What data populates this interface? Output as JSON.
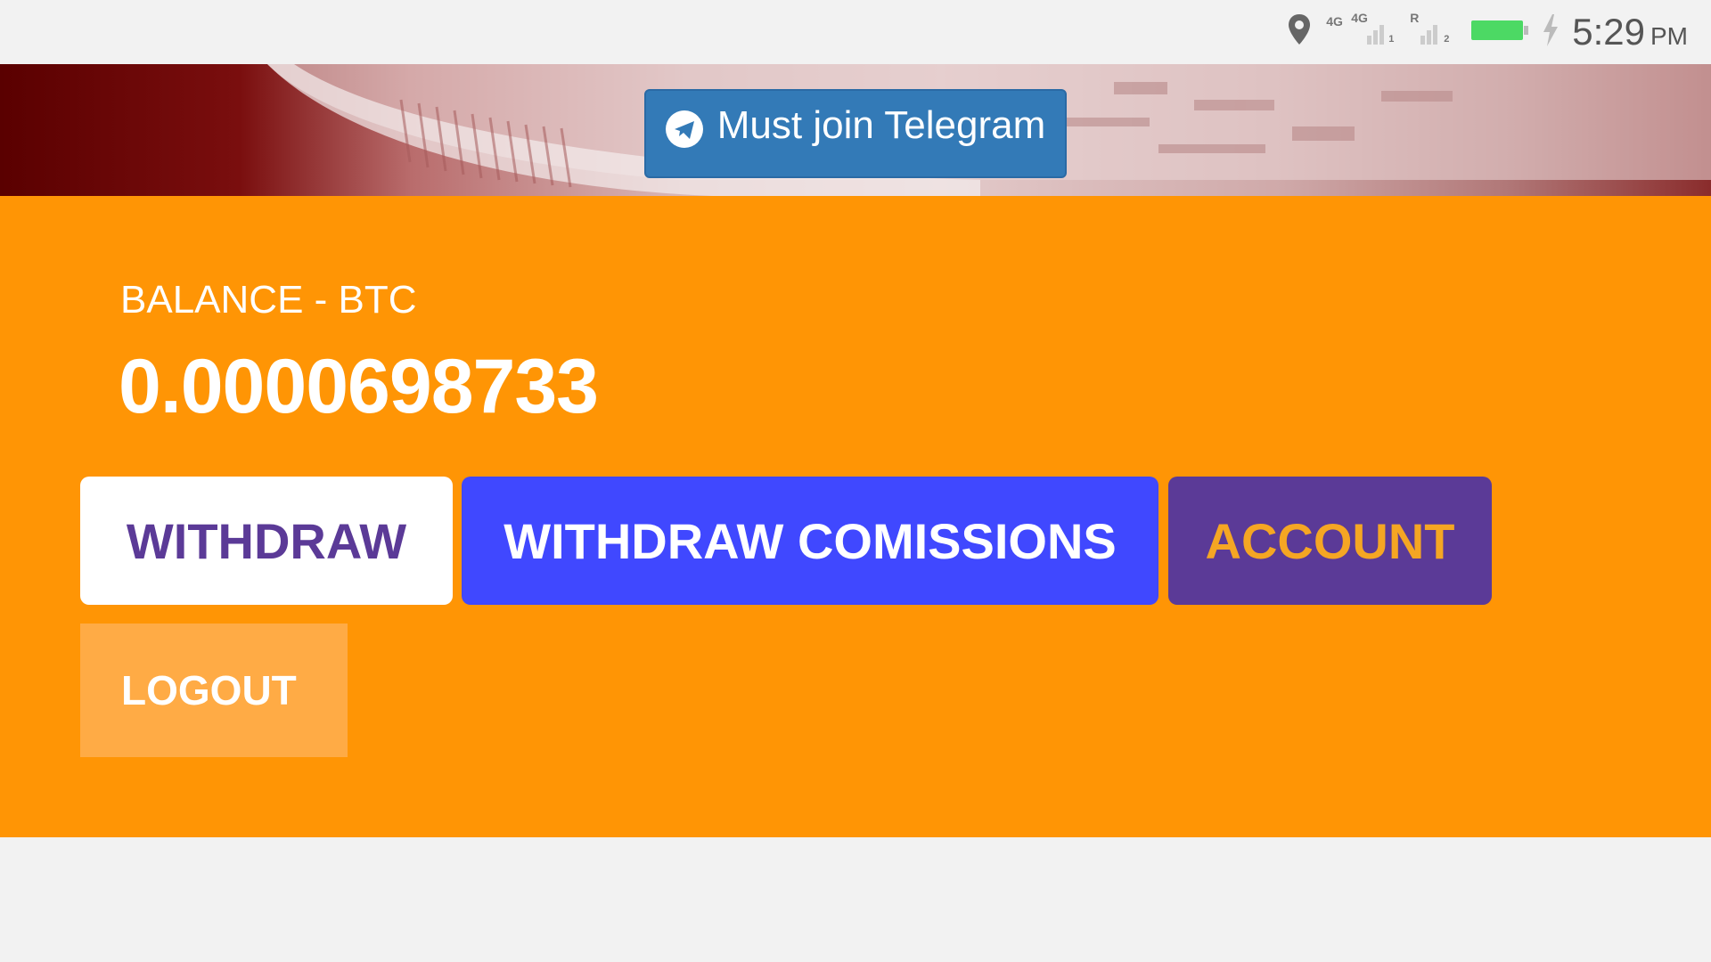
{
  "status_bar": {
    "network_labels": [
      "4G",
      "4G",
      "R",
      "1",
      "2"
    ],
    "time": "5:29",
    "ampm": "PM",
    "battery_color": "#4cd964"
  },
  "hero": {
    "telegram_button_label": "Must join Telegram",
    "icon": "telegram-icon"
  },
  "balance": {
    "label": "BALANCE - BTC",
    "value": "0.0000698733"
  },
  "actions": {
    "withdraw": "WITHDRAW",
    "withdraw_commissions": "WITHDRAW COMISSIONS",
    "account": "ACCOUNT",
    "logout": "LOGOUT"
  },
  "colors": {
    "panel": "#ff9505",
    "withdraw_text": "#5b3a97",
    "comm_bg": "#4048ff",
    "account_bg": "#5b3a97",
    "account_text": "#f5a623",
    "logout_bg": "#ffab45",
    "telegram_bg": "#337ab7"
  }
}
